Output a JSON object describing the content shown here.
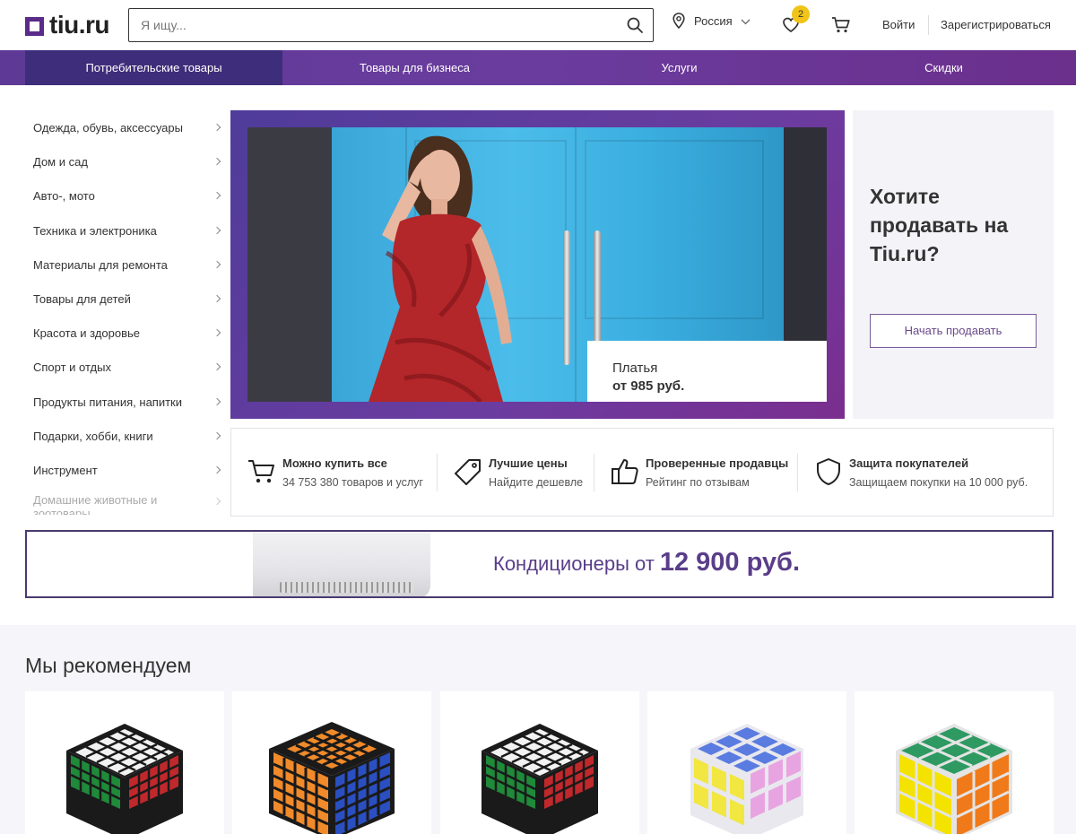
{
  "header": {
    "logo_text": "tiu.ru",
    "search_placeholder": "Я ищу...",
    "region": "Россия",
    "favorites_count": "2",
    "login": "Войти",
    "register": "Зарегистрироваться"
  },
  "nav": {
    "items": [
      {
        "label": "Потребительские товары"
      },
      {
        "label": "Товары для бизнеса"
      },
      {
        "label": "Услуги"
      },
      {
        "label": "Скидки"
      }
    ]
  },
  "categories": [
    {
      "label": "Одежда, обувь, аксессуары"
    },
    {
      "label": "Дом и сад"
    },
    {
      "label": "Авто-, мото"
    },
    {
      "label": "Техника и электроника"
    },
    {
      "label": "Материалы для ремонта"
    },
    {
      "label": "Товары для детей"
    },
    {
      "label": "Красота и здоровье"
    },
    {
      "label": "Спорт и отдых"
    },
    {
      "label": "Продукты питания, напитки"
    },
    {
      "label": "Подарки, хобби, книги"
    },
    {
      "label": "Инструмент"
    },
    {
      "label": "Домашние животные и зоотовары"
    }
  ],
  "hero": {
    "caption_title": "Платья",
    "caption_price": "от 985 руб."
  },
  "sell": {
    "title": "Хотите продавать на Tiu.ru?",
    "button": "Начать продавать"
  },
  "features": [
    {
      "title": "Можно купить все",
      "subtitle": "34 753 380 товаров и услуг",
      "icon": "cart-icon"
    },
    {
      "title": "Лучшие цены",
      "subtitle": "Найдите дешевле",
      "icon": "price-tag-icon"
    },
    {
      "title": "Проверенные продавцы",
      "subtitle": "Рейтинг по отзывам",
      "icon": "thumbs-up-icon"
    },
    {
      "title": "Защита покупателей",
      "subtitle": "Защищаем покупки на 10 000 руб.",
      "icon": "shield-icon"
    }
  ],
  "ac_banner": {
    "text": "Кондиционеры от",
    "price": "12 900 руб."
  },
  "recommend": {
    "title": "Мы рекомендуем"
  },
  "colors": {
    "brand": "#5b2b8a",
    "nav_active": "#3e2d7a",
    "badge": "#f0c419"
  }
}
